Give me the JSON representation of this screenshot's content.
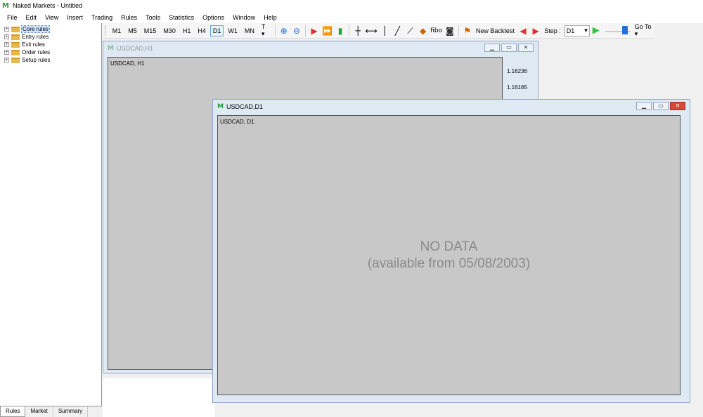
{
  "app": {
    "title": "Naked Markets - Untitled",
    "logo_icon": "naked-markets-logo-icon"
  },
  "menu": [
    "File",
    "Edit",
    "View",
    "Insert",
    "Trading",
    "Rules",
    "Tools",
    "Statistics",
    "Options",
    "Window",
    "Help"
  ],
  "toolbar": {
    "timeframes": [
      "M1",
      "M5",
      "M15",
      "M30",
      "H1",
      "H4",
      "D1",
      "W1",
      "MN"
    ],
    "active_timeframe": "D1",
    "template_label": "T",
    "new_backtest_label": "New Backtest",
    "step_label": "Step :",
    "step_value": "D1",
    "goto_label": "Go To"
  },
  "sidebar": {
    "tree": [
      "Core rules",
      "Entry rules",
      "Exit rules",
      "Order rules",
      "Setup rules"
    ],
    "selected": "Core rules",
    "tabs": [
      "Rules",
      "Market",
      "Summary"
    ],
    "active_tab": "Rules"
  },
  "windows": {
    "h1": {
      "title": "USDCAD,H1",
      "label": "USDCAD, H1",
      "prices": [
        "1.16236",
        "1.16165"
      ]
    },
    "d1": {
      "title": "USDCAD,D1",
      "label": "USDCAD, D1",
      "no_data": "NO DATA",
      "available": "(available from 05/08/2003)"
    }
  },
  "colors": {
    "accent_green": "#2e9b3a",
    "chart_bg": "#c8c8c8",
    "window_frame": "#dfe9f3",
    "close_red": "#d9473a"
  }
}
